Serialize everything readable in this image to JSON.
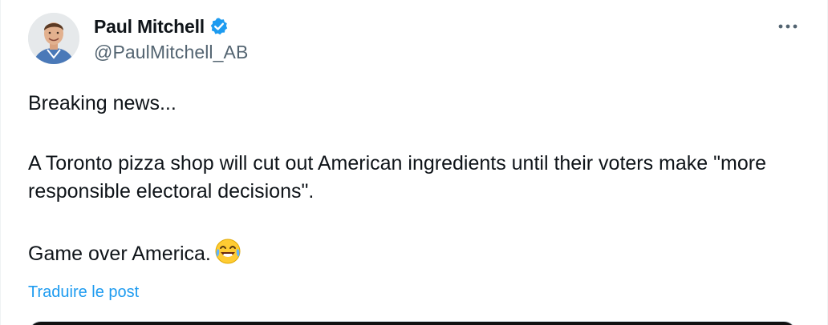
{
  "author": {
    "display_name": "Paul Mitchell",
    "handle": "@PaulMitchell_AB",
    "verified": true,
    "avatar_icon": "profile-photo",
    "verified_icon": "verified-badge-icon",
    "verified_color": "#1d9bf0"
  },
  "menu": {
    "icon": "more-options-icon"
  },
  "tweet": {
    "line1": "Breaking news...",
    "line2": "A Toronto pizza shop will cut out American ingredients until their voters make \"more responsible electoral decisions\".",
    "line3": "Game over America.",
    "emoji": "face-with-tears-of-joy"
  },
  "translate_label": "Traduire le post",
  "colors": {
    "text": "#0f1419",
    "secondary": "#536471",
    "link": "#1d9bf0"
  }
}
